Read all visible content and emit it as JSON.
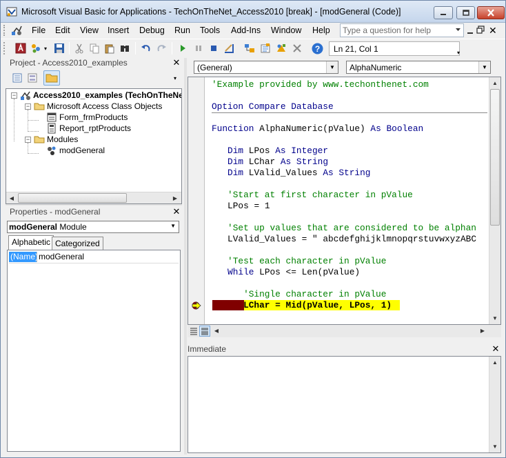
{
  "window": {
    "title": "Microsoft Visual Basic for Applications - TechOnTheNet_Access2010 [break] - [modGeneral (Code)]"
  },
  "menu": {
    "items": [
      "File",
      "Edit",
      "View",
      "Insert",
      "Debug",
      "Run",
      "Tools",
      "Add-Ins",
      "Window",
      "Help"
    ],
    "help_placeholder": "Type a question for help"
  },
  "toolbar": {
    "position": "Ln 21, Col 1"
  },
  "project": {
    "title": "Project - Access2010_examples",
    "root": "Access2010_examples (TechOnTheNe",
    "class_folder": "Microsoft Access Class Objects",
    "form": "Form_frmProducts",
    "report": "Report_rptProducts",
    "modules_folder": "Modules",
    "module": "modGeneral"
  },
  "properties": {
    "title": "Properties - modGeneral",
    "object_name": "modGeneral",
    "object_type": "Module",
    "tab_alphabetic": "Alphabetic",
    "tab_categorized": "Categorized",
    "prop_name": "(Name)",
    "prop_value": "modGeneral"
  },
  "code": {
    "object_combo": "(General)",
    "proc_combo": "AlphaNumeric",
    "lines": [
      {
        "text": "'Example provided by www.techonthenet.com",
        "kind": "comment"
      },
      {
        "text": "",
        "kind": "text"
      },
      {
        "text": "Option Compare Database",
        "kind": "kw"
      },
      {
        "text": "",
        "kind": "text"
      },
      {
        "text": "Function AlphaNumeric(pValue) As Boolean",
        "kind": "mixed"
      },
      {
        "text": "",
        "kind": "text"
      },
      {
        "text": "   Dim LPos As Integer",
        "kind": "mixed"
      },
      {
        "text": "   Dim LChar As String",
        "kind": "mixed"
      },
      {
        "text": "   Dim LValid_Values As String",
        "kind": "mixed"
      },
      {
        "text": "",
        "kind": "text"
      },
      {
        "text": "   'Start at first character in pValue",
        "kind": "comment"
      },
      {
        "text": "   LPos = 1",
        "kind": "text"
      },
      {
        "text": "",
        "kind": "text"
      },
      {
        "text": "   'Set up values that are considered to be alphan",
        "kind": "comment"
      },
      {
        "text": "   LValid_Values = \" abcdefghijklmnopqrstuvwxyzABC",
        "kind": "text"
      },
      {
        "text": "",
        "kind": "text"
      },
      {
        "text": "   'Test each character in pValue",
        "kind": "comment"
      },
      {
        "text": "   While LPos <= Len(pValue)",
        "kind": "mixed"
      },
      {
        "text": "",
        "kind": "text"
      },
      {
        "text": "      'Single character in pValue",
        "kind": "comment"
      },
      {
        "text": "      LChar = Mid(pValue, LPos, 1)",
        "kind": "exec"
      }
    ]
  },
  "immediate": {
    "title": "Immediate"
  },
  "colors": {
    "comment": "#008000",
    "keyword": "#00008b",
    "execution_highlight": "#ffff00",
    "breakpoint": "#800000"
  },
  "icons": [
    "vba-app-icon",
    "minimize-icon",
    "maximize-icon",
    "close-icon",
    "view-access-icon",
    "insert-module-icon",
    "save-icon",
    "cut-icon",
    "copy-icon",
    "paste-icon",
    "find-icon",
    "undo-icon",
    "redo-icon",
    "run-icon",
    "break-icon",
    "reset-icon",
    "design-mode-icon",
    "project-explorer-icon",
    "properties-window-icon",
    "object-browser-icon",
    "toolbox-icon",
    "help-icon",
    "view-code-icon",
    "view-object-icon",
    "toggle-folders-icon",
    "project-icon",
    "folder-icon",
    "form-icon",
    "report-icon",
    "module-icon",
    "execution-arrow-icon"
  ]
}
